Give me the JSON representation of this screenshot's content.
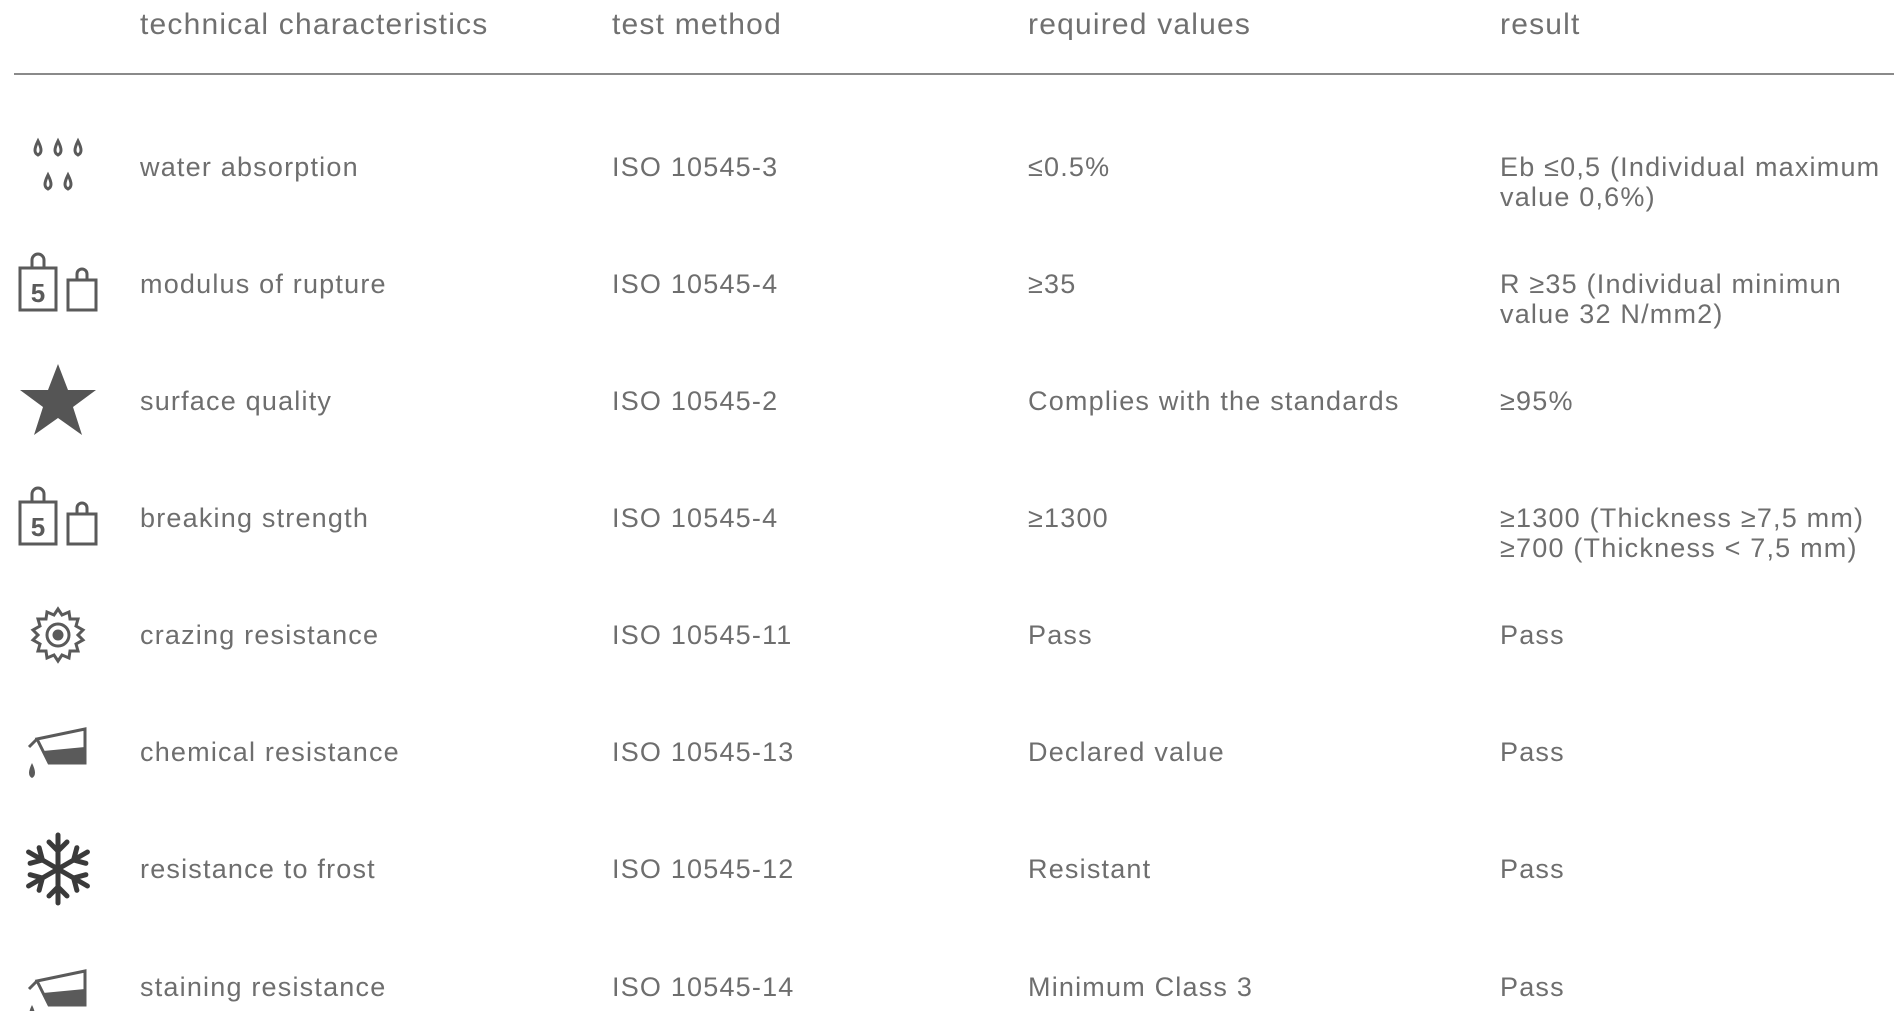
{
  "header": {
    "technical_characteristics": "technical characteristics",
    "test_method": "test method",
    "required_values": "required values",
    "result": "result"
  },
  "rows": [
    {
      "icon": "water-drops-icon",
      "characteristic": "water absorption",
      "method": "ISO 10545-3",
      "required": "≤0.5%",
      "result": "Eb ≤0,5 (Individual maximum\nvalue 0,6%)"
    },
    {
      "icon": "weight-icon",
      "icon_text": "5",
      "characteristic": "modulus of rupture",
      "method": "ISO 10545-4",
      "required": "≥35",
      "result": "R ≥35 (Individual minimun\nvalue 32 N/mm2)"
    },
    {
      "icon": "star-icon",
      "characteristic": "surface quality",
      "method": "ISO 10545-2",
      "required": "Complies with the standards",
      "result": "≥95%"
    },
    {
      "icon": "weight-icon",
      "icon_text": "5",
      "characteristic": "breaking strength",
      "method": "ISO 10545-4",
      "required": "≥1300",
      "result": "≥1300 (Thickness ≥7,5 mm)\n≥700 (Thickness < 7,5 mm)"
    },
    {
      "icon": "crazing-gear-icon",
      "characteristic": "crazing resistance",
      "method": "ISO 10545-11",
      "required": "Pass",
      "result": "Pass"
    },
    {
      "icon": "chemical-beaker-icon",
      "characteristic": "chemical resistance",
      "method": "ISO 10545-13",
      "required": "Declared value",
      "result": "Pass"
    },
    {
      "icon": "snowflake-icon",
      "characteristic": "resistance to frost",
      "method": "ISO 10545-12",
      "required": "Resistant",
      "result": "Pass"
    },
    {
      "icon": "staining-beaker-icon",
      "characteristic": "staining resistance",
      "method": "ISO 10545-14",
      "required": "Minimum Class 3",
      "result": "Pass"
    }
  ],
  "colors": {
    "text": "#6e6e6e",
    "icon": "#5a5a5a",
    "divider": "#8a8a8a"
  }
}
